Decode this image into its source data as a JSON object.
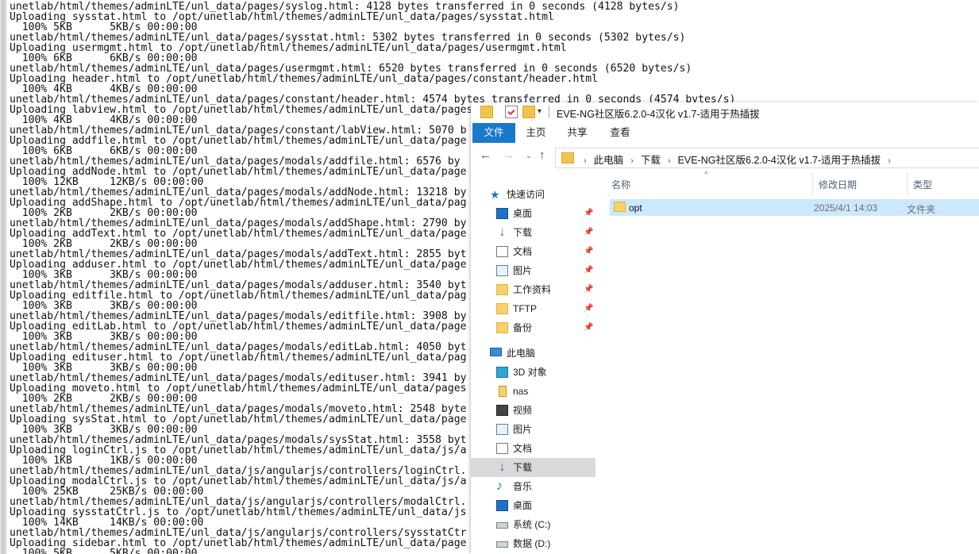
{
  "terminal": {
    "lines": [
      "unetlab/html/themes/adminLTE/unl_data/pages/syslog.html: 4128 bytes transferred in 0 seconds (4128 bytes/s)",
      "Uploading sysstat.html to /opt/unetlab/html/themes/adminLTE/unl_data/pages/sysstat.html",
      "  100% 5KB      5KB/s 00:00:00",
      "unetlab/html/themes/adminLTE/unl_data/pages/sysstat.html: 5302 bytes transferred in 0 seconds (5302 bytes/s)",
      "Uploading usermgmt.html to /opt/unetlab/html/themes/adminLTE/unl_data/pages/usermgmt.html",
      "  100% 6KB      6KB/s 00:00:00",
      "unetlab/html/themes/adminLTE/unl_data/pages/usermgmt.html: 6520 bytes transferred in 0 seconds (6520 bytes/s)",
      "Uploading header.html to /opt/unetlab/html/themes/adminLTE/unl_data/pages/constant/header.html",
      "  100% 4KB      4KB/s 00:00:00",
      "unetlab/html/themes/adminLTE/unl_data/pages/constant/header.html: 4574 bytes transferred in 0 seconds (4574 bytes/s)",
      "Uploading labview.html to /opt/unetlab/html/themes/adminLTE/unl_data/pages/constant/labView.html",
      "  100% 4KB      4KB/s 00:00:00",
      "unetlab/html/themes/adminLTE/unl_data/pages/constant/labView.html: 5070 b",
      "Uploading addfile.html to /opt/unetlab/html/themes/adminLTE/unl_data/page",
      "  100% 6KB      6KB/s 00:00:00",
      "unetlab/html/themes/adminLTE/unl_data/pages/modals/addfile.html: 6576 by",
      "Uploading addNode.html to /opt/unetlab/html/themes/adminLTE/unl_data/page",
      "  100% 12KB     12KB/s 00:00:00",
      "unetlab/html/themes/adminLTE/unl_data/pages/modals/addNode.html: 13218 by",
      "Uploading addShape.html to /opt/unetlab/html/themes/adminLTE/unl_data/pag",
      "  100% 2KB      2KB/s 00:00:00",
      "unetlab/html/themes/adminLTE/unl_data/pages/modals/addShape.html: 2790 by",
      "Uploading addText.html to /opt/unetlab/html/themes/adminLTE/unl_data/page",
      "  100% 2KB      2KB/s 00:00:00",
      "unetlab/html/themes/adminLTE/unl_data/pages/modals/addText.html: 2855 byt",
      "Uploading adduser.html to /opt/unetlab/html/themes/adminLTE/unl_data/page",
      "  100% 3KB      3KB/s 00:00:00",
      "unetlab/html/themes/adminLTE/unl_data/pages/modals/adduser.html: 3540 byt",
      "Uploading editfile.html to /opt/unetlab/html/themes/adminLTE/unl_data/pag",
      "  100% 3KB      3KB/s 00:00:00",
      "unetlab/html/themes/adminLTE/unl_data/pages/modals/editfile.html: 3908 by",
      "Uploading editLab.html to /opt/unetlab/html/themes/adminLTE/unl_data/page",
      "  100% 3KB      3KB/s 00:00:00",
      "unetlab/html/themes/adminLTE/unl_data/pages/modals/editLab.html: 4050 byt",
      "Uploading edituser.html to /opt/unetlab/html/themes/adminLTE/unl_data/pag",
      "  100% 3KB      3KB/s 00:00:00",
      "unetlab/html/themes/adminLTE/unl_data/pages/modals/edituser.html: 3941 by",
      "Uploading moveto.html to /opt/unetlab/html/themes/adminLTE/unl_data/pages",
      "  100% 2KB      2KB/s 00:00:00",
      "unetlab/html/themes/adminLTE/unl_data/pages/modals/moveto.html: 2548 byte",
      "Uploading sysStat.html to /opt/unetlab/html/themes/adminLTE/unl_data/page",
      "  100% 3KB      3KB/s 00:00:00",
      "unetlab/html/themes/adminLTE/unl_data/pages/modals/sysStat.html: 3558 byt",
      "Uploading loginCtrl.js to /opt/unetlab/html/themes/adminLTE/unl_data/js/a",
      "  100% 1KB      1KB/s 00:00:00",
      "unetlab/html/themes/adminLTE/unl_data/js/angularjs/controllers/loginCtrl.",
      "Uploading modalCtrl.js to /opt/unetlab/html/themes/adminLTE/unl_data/js/a",
      "  100% 25KB     25KB/s 00:00:00",
      "unetlab/html/themes/adminLTE/unl_data/js/angularjs/controllers/modalCtrl.",
      "Uploading sysstatCtrl.js to /opt/unetlab/html/themes/adminLTE/unl_data/js",
      "  100% 14KB     14KB/s 00:00:00",
      "unetlab/html/themes/adminLTE/unl_data/js/angularjs/controllers/sysstatCtr",
      "Uploading sidebar.html to /opt/unetlab/html/themes/adminLTE/unl_data/page",
      "  100% 5KB      5KB/s 00:00:00"
    ]
  },
  "explorer": {
    "title": "EVE-NG社区版6.2.0-4汉化 v1.7-适用于热插拔",
    "qa_dropdown": "▾",
    "ribbon_tabs": [
      "文件",
      "主页",
      "共享",
      "查看"
    ],
    "nav_buttons": {
      "back": "←",
      "forward": "→",
      "recent": "⌄",
      "up": "↑"
    },
    "address": {
      "segments": [
        "此电脑",
        "下载",
        "EVE-NG社区版6.2.0-4汉化 v1.7-适用于热插拔"
      ],
      "separator": "›"
    },
    "nav_pane": {
      "quick_access": "快速访问",
      "quick_items": [
        "桌面",
        "下载",
        "文档",
        "图片",
        "工作资料",
        "TFTP",
        "备份"
      ],
      "pin_glyph": "📌",
      "this_pc": "此电脑",
      "pc_items": [
        "3D 对象",
        "nas",
        "视频",
        "图片",
        "文档",
        "下载",
        "音乐",
        "桌面",
        "系统 (C:)",
        "数据 (D:)"
      ],
      "selected": "下载"
    },
    "columns": {
      "name": "名称",
      "date": "修改日期",
      "type": "类型",
      "sort_arrow": "^"
    },
    "files": [
      {
        "name": "opt",
        "date": "2025/4/1 14:03",
        "type": "文件夹"
      }
    ],
    "colors": {
      "file_tab": "#1979ca",
      "selection": "#cce8ff",
      "nav_selected": "#d9d9d9",
      "folder": "#f7d16a"
    }
  }
}
